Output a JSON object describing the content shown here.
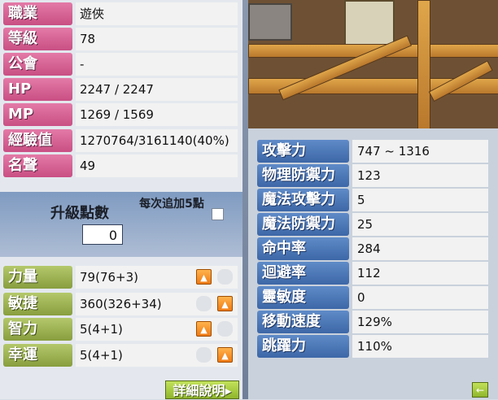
{
  "profile": [
    {
      "label": "職業",
      "value": "遊俠"
    },
    {
      "label": "等級",
      "value": "78"
    },
    {
      "label": "公會",
      "value": "-"
    },
    {
      "label": "HP",
      "value": "2247 / 2247"
    },
    {
      "label": "MP",
      "value": "1269 / 1569"
    },
    {
      "label": "經驗值",
      "value": "1270764/3161140(40%)"
    },
    {
      "label": "名聲",
      "value": "49"
    }
  ],
  "points": {
    "title": "升級點數",
    "value": "0",
    "note": "每次追加5點",
    "checked": false
  },
  "stats": [
    {
      "label": "力量",
      "value": "79(76+3)",
      "up_icon": "arrow-up-icon"
    },
    {
      "label": "敏捷",
      "value": "360(326+34)",
      "up_icon": "arrow-up-icon"
    },
    {
      "label": "智力",
      "value": "5(4+1)",
      "up_icon": "arrow-up-icon"
    },
    {
      "label": "幸運",
      "value": "5(4+1)",
      "up_icon": "arrow-up-icon"
    }
  ],
  "detail_button": {
    "label": "詳細說明▸"
  },
  "attributes": [
    {
      "label": "攻擊力",
      "value": "747 ~ 1316"
    },
    {
      "label": "物理防禦力",
      "value": "123"
    },
    {
      "label": "魔法攻擊力",
      "value": "5"
    },
    {
      "label": "魔法防禦力",
      "value": "25"
    },
    {
      "label": "命中率",
      "value": "284"
    },
    {
      "label": "迴避率",
      "value": "112"
    },
    {
      "label": "靈敏度",
      "value": "0"
    },
    {
      "label": "移動速度",
      "value": "129%"
    },
    {
      "label": "跳躍力",
      "value": "110%"
    }
  ],
  "back_button": {
    "icon": "arrow-left-icon",
    "label": "←"
  },
  "colors": {
    "profile_label": "#d35e92",
    "stat_label": "#9cb450",
    "attr_label": "#4d79ba",
    "accent": "#f08a1a"
  }
}
